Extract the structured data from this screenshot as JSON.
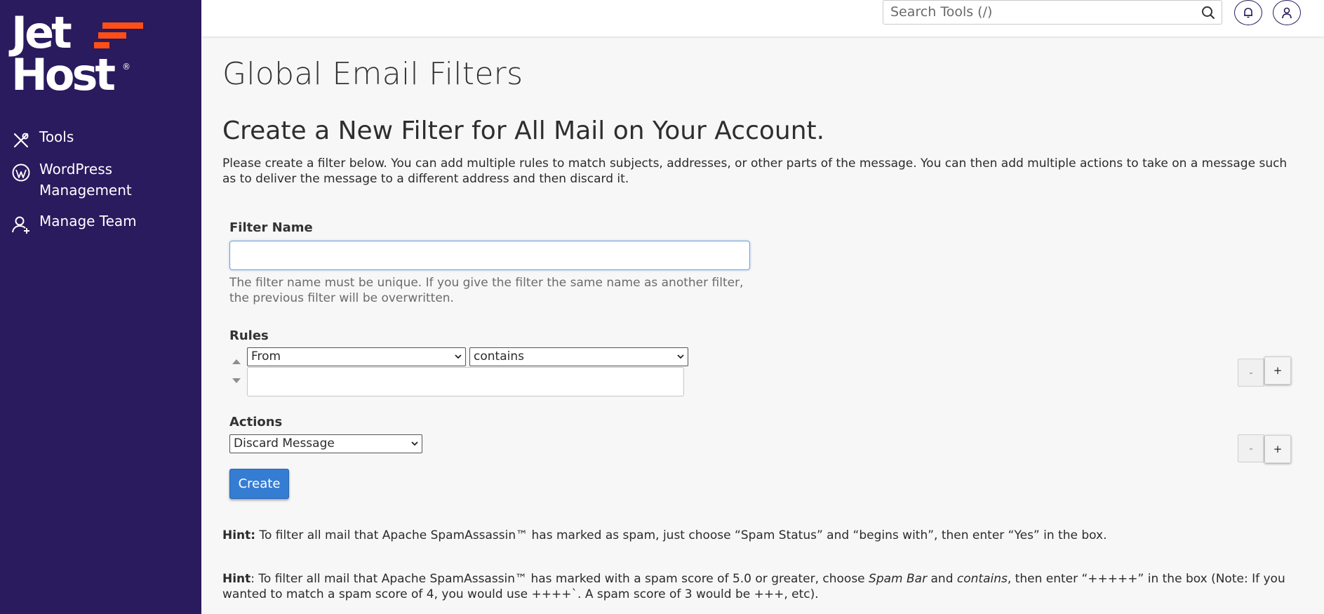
{
  "brand": {
    "word1": "Jet",
    "word2": "Host",
    "reg": "®",
    "accent_color": "#ff4f17",
    "sidebar_color": "#2a1a5e"
  },
  "sidebar": {
    "items": [
      {
        "label": "Tools",
        "icon": "tools-icon"
      },
      {
        "label": "WordPress Management",
        "line1": "WordPress",
        "line2": "Management",
        "icon": "wordpress-icon"
      },
      {
        "label": "Manage Team",
        "icon": "team-icon"
      }
    ]
  },
  "header": {
    "search_placeholder": "Search Tools (/)",
    "icons": [
      "search-icon",
      "bell-icon",
      "user-icon"
    ]
  },
  "main": {
    "page_title": "Global Email Filters",
    "section_title": "Create a New Filter for All Mail on Your Account.",
    "intro": "Please create a filter below. You can add multiple rules to match subjects, addresses, or other parts of the message. You can then add multiple actions to take on a message such as to deliver the message to a different address and then discard it.",
    "filter_name": {
      "label": "Filter Name",
      "value": "",
      "help": "The filter name must be unique. If you give the filter the same name as another filter, the previous filter will be overwritten."
    },
    "rules": {
      "label": "Rules",
      "field_selected": "From",
      "operator_selected": "contains",
      "value": "",
      "minus_label": "-",
      "plus_label": "+"
    },
    "actions": {
      "label": "Actions",
      "selected": "Discard Message",
      "minus_label": "-",
      "plus_label": "+"
    },
    "create_label": "Create",
    "create_color": "#357dd3",
    "hint1": {
      "bold": "Hint:",
      "text": " To filter all mail that Apache SpamAssassin™ has marked as spam, just choose “Spam Status” and “begins with”, then enter “Yes” in the box."
    },
    "hint2": {
      "bold": "Hint",
      "t1": ": To filter all mail that Apache SpamAssassin™ has marked with a spam score of 5.0 or greater, choose ",
      "em1": "Spam Bar",
      "t2": " and ",
      "em2": "contains",
      "t3": ", then enter “+++++” in the box (Note: If you wanted to match a spam score of 4, you would use ++++`. A spam score of 3 would be +++, etc)."
    }
  }
}
